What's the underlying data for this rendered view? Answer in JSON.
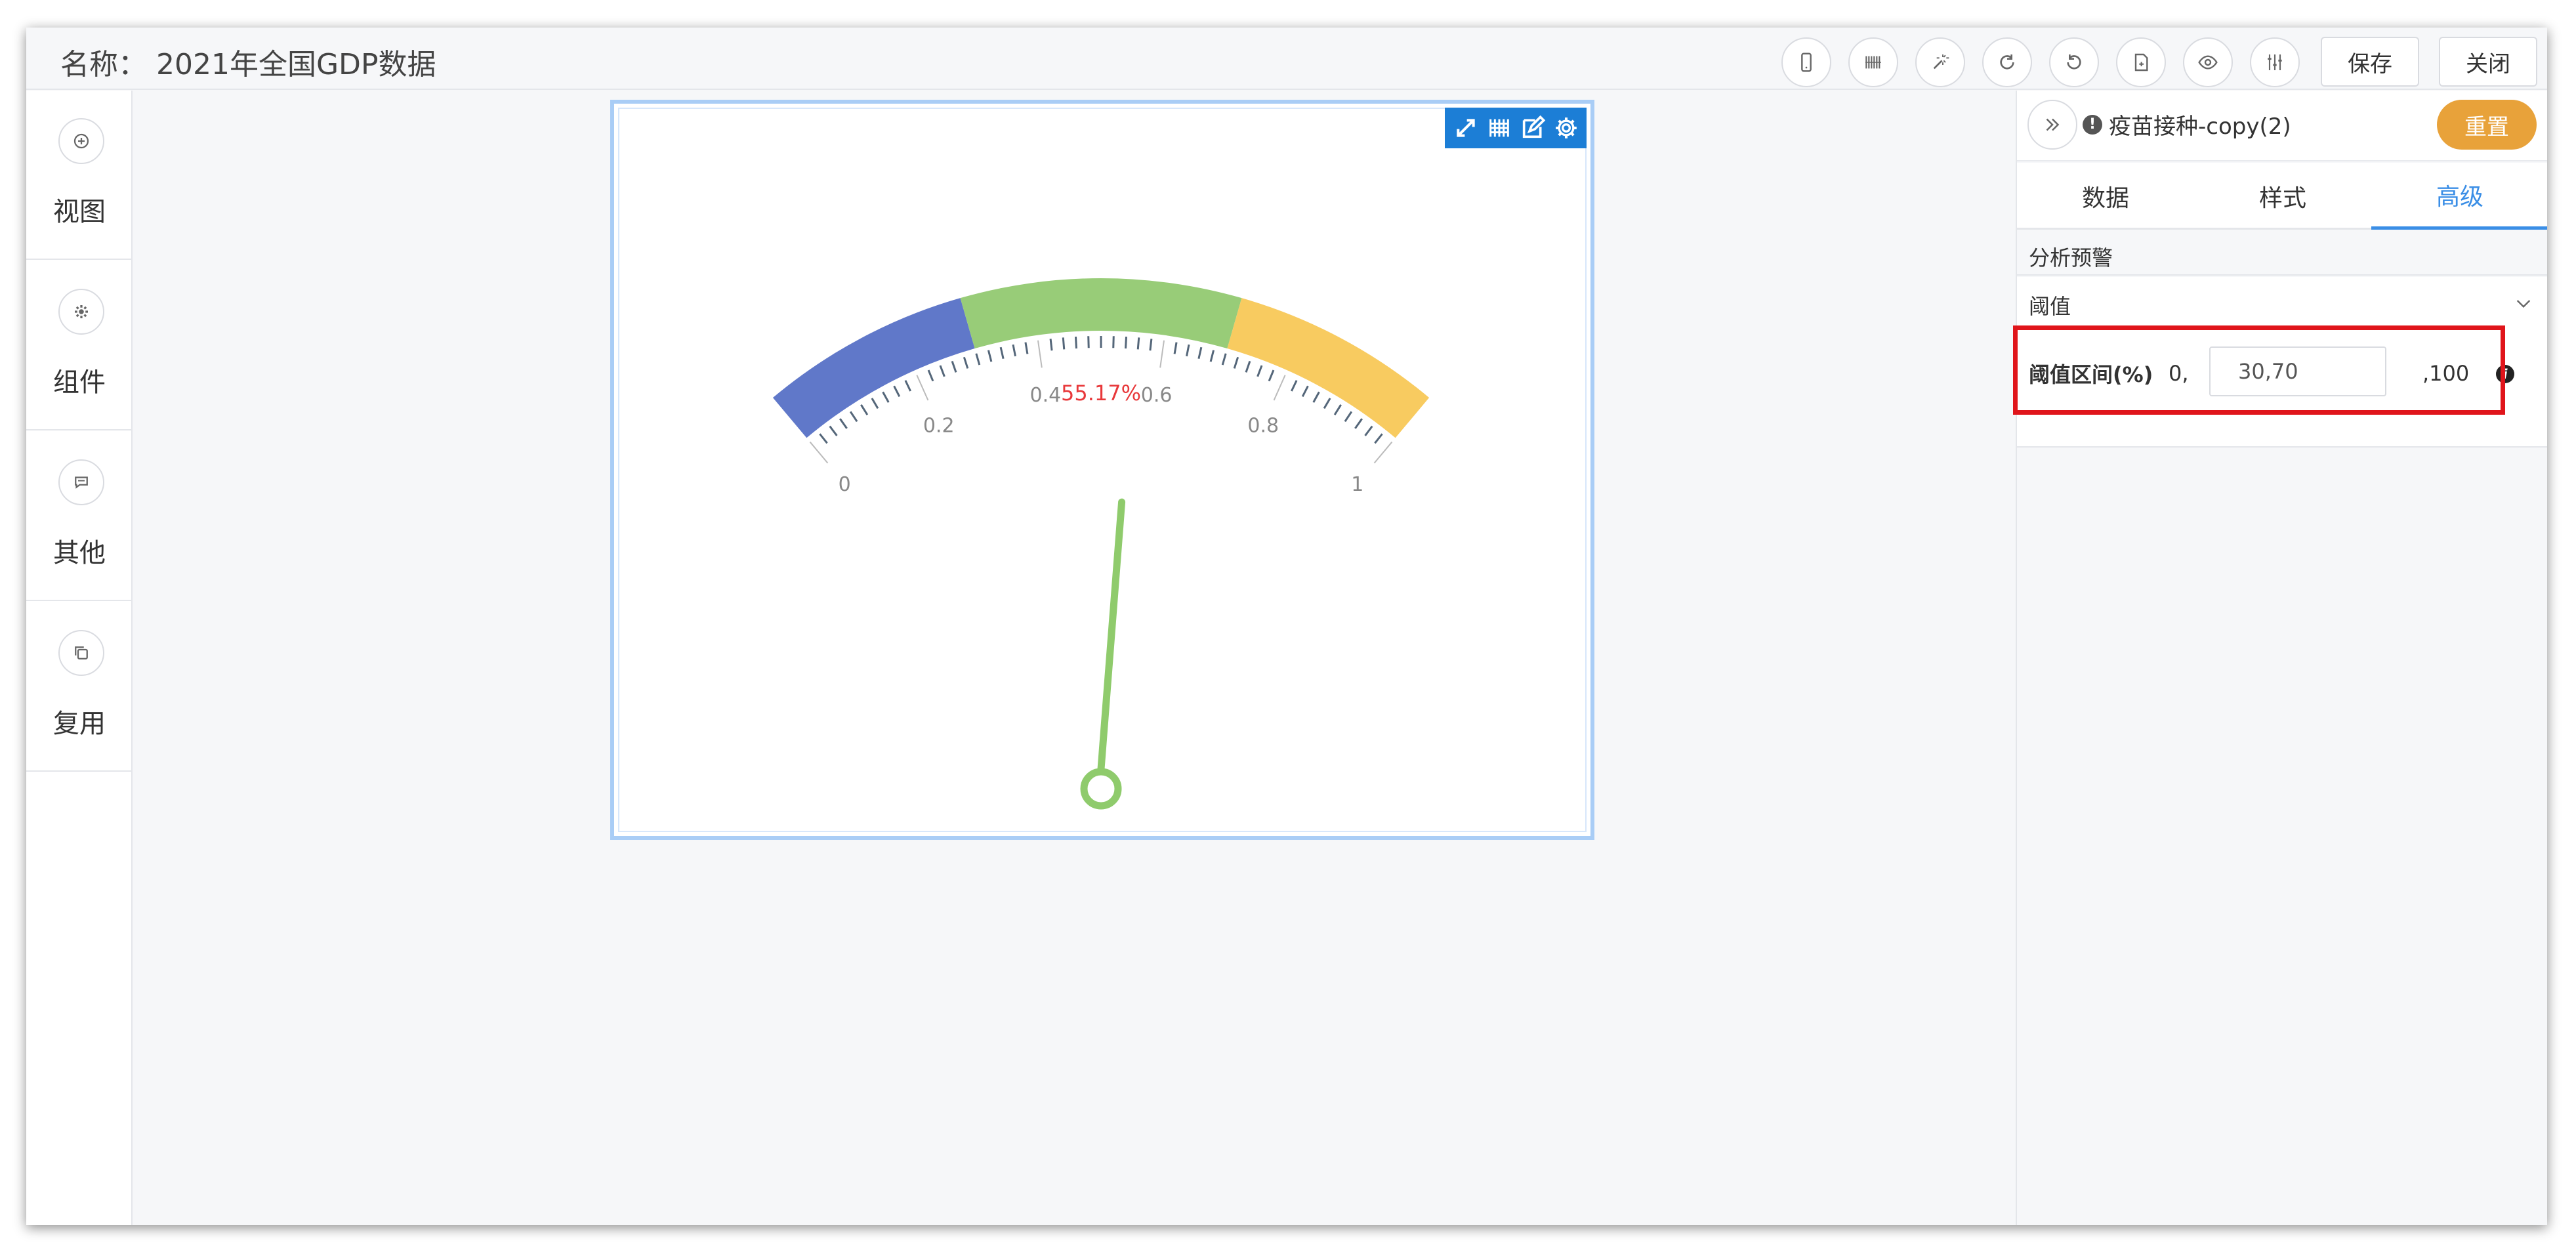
{
  "header": {
    "title": "名称： 2021年全国GDP数据",
    "save_label": "保存",
    "close_label": "关闭",
    "toolbar_icons": [
      "mobile-icon",
      "barcode-icon",
      "magic-icon",
      "refresh-icon",
      "undo-icon",
      "export-icon",
      "eye-icon",
      "sliders-icon"
    ]
  },
  "sidebar": {
    "items": [
      {
        "label": "视图",
        "icon": "plus-circle-icon"
      },
      {
        "label": "组件",
        "icon": "gear-icon"
      },
      {
        "label": "其他",
        "icon": "chat-icon"
      },
      {
        "label": "复用",
        "icon": "copy-icon"
      }
    ]
  },
  "widget": {
    "toolbar_icons": [
      "expand-icon",
      "grid-icon",
      "edit-icon",
      "settings-icon"
    ],
    "value_label": "55.17%"
  },
  "chart_data": {
    "type": "gauge",
    "value": 0.5517,
    "min": 0,
    "max": 1,
    "tick_labels": [
      "0",
      "0.2",
      "0.4",
      "0.6",
      "0.8",
      "1"
    ],
    "bands": [
      {
        "from": 0,
        "to": 0.3,
        "color": "#6078c9"
      },
      {
        "from": 0.3,
        "to": 0.7,
        "color": "#98cc78"
      },
      {
        "from": 0.7,
        "to": 1,
        "color": "#f8cb60"
      }
    ],
    "pointer_color": "#8fcb6c",
    "value_color": "#e8383a"
  },
  "panel": {
    "widget_name": "疫苗接种-copy(2)",
    "reset_label": "重置",
    "tabs": [
      {
        "label": "数据",
        "active": false
      },
      {
        "label": "样式",
        "active": false
      },
      {
        "label": "高级",
        "active": true
      }
    ],
    "section_title": "分析预警",
    "threshold": {
      "header": "阈值",
      "label": "阈值区间(%)",
      "min_text": "0,",
      "value": "30,70",
      "max_text": ",100"
    }
  },
  "colors": {
    "accent": "#3a8ee6",
    "reset": "#e8a23a",
    "highlight": "#e0151b",
    "widget_toolbar": "#1c7ed6"
  }
}
